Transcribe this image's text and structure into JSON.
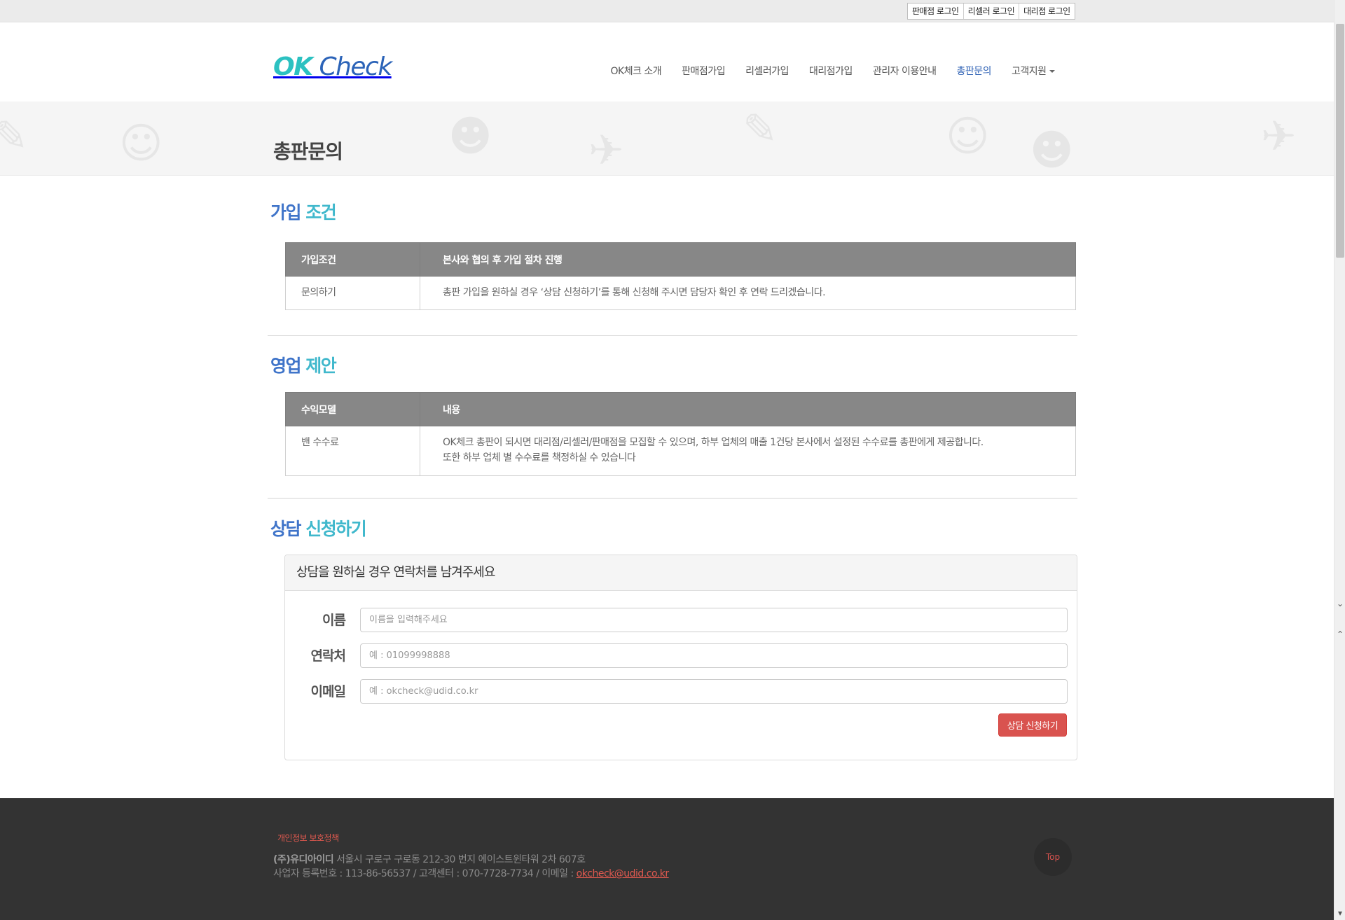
{
  "topbar": {
    "logins": [
      "판매점 로그인",
      "리셀러 로그인",
      "대리점 로그인"
    ]
  },
  "header": {
    "logo_ok": "OK",
    "logo_check": "Check",
    "nav": [
      "OK체크 소개",
      "판매점가입",
      "리셀러가입",
      "대리점가입",
      "관리자 이용안내",
      "총판문의",
      "고객지원"
    ],
    "active_nav": "총판문의"
  },
  "banner": {
    "title": "총판문의"
  },
  "section1": {
    "title_a": "가입",
    "title_b": "조건",
    "table": {
      "headers": [
        "가입조건",
        "본사와 협의 후 가입 절차 진행"
      ],
      "rows": [
        [
          "문의하기",
          "총판 가입을 원하실 경우 ‘상담 신청하기’를 통해 신청해 주시면 담당자 확인 후 연락 드리겠습니다."
        ]
      ]
    }
  },
  "section2": {
    "title_a": "영업",
    "title_b": "제안",
    "table": {
      "headers": [
        "수익모델",
        "내용"
      ],
      "rows": [
        [
          "밴 수수료",
          "OK체크 총판이 되시면 대리점/리셀러/판매점을 모집할 수 있으며, 하부 업체의 매출 1건당 본사에서 설정된 수수료를 총판에게 제공합니다.",
          "또한 하부 업체 별 수수료를 책정하실 수 있습니다"
        ]
      ]
    }
  },
  "section3": {
    "title_a": "상담",
    "title_b": "신청하기",
    "panel_heading": "상담을 원하실 경우 연락처를 남겨주세요",
    "fields": [
      {
        "label": "이름",
        "placeholder": "이름을 입력해주세요"
      },
      {
        "label": "연락처",
        "placeholder": "예 : 01099998888"
      },
      {
        "label": "이메일",
        "placeholder": "예 : okcheck@udid.co.kr"
      }
    ],
    "submit_label": "상담 신청하기"
  },
  "footer": {
    "privacy": "개인정보 보호정책",
    "company": "(주)유디아이디",
    "address": " 서울시 구로구 구로동 212-30 번지 에이스트윈타워 2차 607호",
    "business": "사업자 등록번호 : 113-86-56537 / 고객센터 : 070-7728-7734 / 이메일 : ",
    "email": "okcheck@udid.co.kr",
    "top": "Top"
  },
  "icons": {
    "caret": "chevron-down-icon",
    "scroll_up": "chevron-up-icon",
    "scroll_down": "chevron-down-icon"
  }
}
